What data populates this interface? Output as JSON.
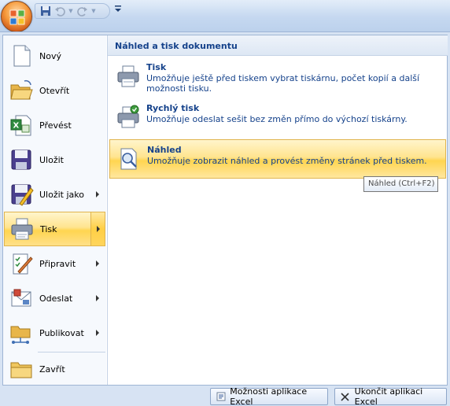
{
  "office_menu": {
    "commands": [
      {
        "label": "Nový",
        "icon": "new-document-icon"
      },
      {
        "label": "Otevřít",
        "icon": "open-folder-icon"
      },
      {
        "label": "Převést",
        "icon": "convert-icon"
      },
      {
        "label": "Uložit",
        "icon": "save-icon"
      },
      {
        "label": "Uložit jako",
        "icon": "save-as-icon",
        "submenu": true
      },
      {
        "label": "Tisk",
        "icon": "printer-icon",
        "submenu": true,
        "selected": true
      },
      {
        "label": "Připravit",
        "icon": "prepare-icon",
        "submenu": true
      },
      {
        "label": "Odeslat",
        "icon": "send-icon",
        "submenu": true
      },
      {
        "label": "Publikovat",
        "icon": "publish-icon",
        "submenu": true
      },
      {
        "label": "Zavřít",
        "icon": "close-folder-icon"
      }
    ],
    "submenu": {
      "header": "Náhled a tisk dokumentu",
      "items": [
        {
          "title": "Tisk",
          "description": "Umožňuje ještě před tiskem vybrat tiskárnu, počet kopií a další možnosti tisku.",
          "icon": "printer-icon"
        },
        {
          "title": "Rychlý tisk",
          "description": "Umožňuje odeslat sešit bez změn přímo do výchozí tiskárny.",
          "icon": "quick-print-icon"
        },
        {
          "title": "Náhled",
          "description": "Umožňuje zobrazit náhled a provést změny stránek před tiskem.",
          "icon": "print-preview-icon",
          "hot": true
        }
      ],
      "tooltip": "Náhled (Ctrl+F2)"
    },
    "footer": {
      "options_label": "Možnosti aplikace Excel",
      "exit_label": "Ukončit aplikaci Excel"
    }
  },
  "colors": {
    "accent_text": "#15428b",
    "highlight": "#ffd550",
    "office_button": "#f69b3c"
  }
}
